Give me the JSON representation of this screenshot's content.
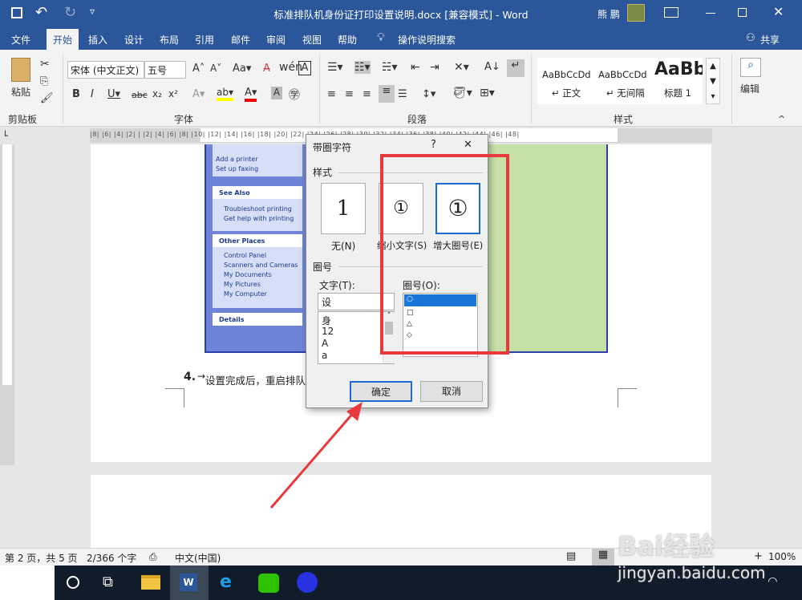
{
  "titlebar": {
    "title": "标准排队机身份证打印设置说明.docx [兼容模式] - Word",
    "user": "熊 鹏"
  },
  "tabs": [
    "文件",
    "开始",
    "插入",
    "设计",
    "布局",
    "引用",
    "邮件",
    "审阅",
    "视图",
    "帮助"
  ],
  "tellme": "操作说明搜索",
  "share": "共享",
  "ribbon": {
    "paste": "粘贴",
    "clipboard": "剪贴板",
    "font_name": "宋体 (中文正文)",
    "font_size": "五号",
    "font_group": "字体",
    "para_group": "段落",
    "styles_group": "样式",
    "edit": "编辑",
    "styles": [
      {
        "preview": "AaBbCcDd",
        "name": "↵ 正文"
      },
      {
        "preview": "AaBbCcDd",
        "name": "↵ 无间隔"
      },
      {
        "preview": "AaBb",
        "name": "标题 1"
      }
    ]
  },
  "ruler_marks": "|8| |6| |4| |2| | |2| |4| |6| |8| |10| |12| |14| |16| |18| |20| |22| |24| |26| |28| |30| |32| |34| |36| |38| |40| |42| |44| |46| |48|",
  "xp_panel": {
    "printer_tasks": [
      "Add a printer",
      "Set up faxing"
    ],
    "see_also": "See Also",
    "see_also_items": [
      "Troubleshoot printing",
      "Get help with printing"
    ],
    "other_places": "Other Places",
    "other_items": [
      "Control Panel",
      "Scanners and Cameras",
      "My Documents",
      "My Pictures",
      "My Computer"
    ],
    "details": "Details"
  },
  "doc": {
    "step_num": "4.",
    "step_text": "设置完成后，重启排队"
  },
  "dialog": {
    "title": "带圈字符",
    "help": "?",
    "close": "✕",
    "style_label": "样式",
    "options": [
      {
        "glyph": "1",
        "label": "无(N)"
      },
      {
        "glyph": "①",
        "label": "缩小文字(S)"
      },
      {
        "glyph": "①",
        "label": "增大圈号(E)"
      }
    ],
    "circle_label": "圈号",
    "text_label": "文字(T):",
    "text_value": "设",
    "text_items": [
      "身",
      "12",
      "A",
      "a"
    ],
    "enclosure_label": "圈号(O):",
    "enclosure_items": [
      "○",
      "□",
      "△",
      "◇"
    ],
    "ok": "确定",
    "cancel": "取消"
  },
  "status": {
    "page": "第 2 页，共 5 页",
    "words": "2/366 个字",
    "lang": "中文(中国)",
    "zoom": "100%"
  },
  "watermark": {
    "logo": "Bai经验",
    "url": "jingyan.baidu.com"
  },
  "colors": {
    "word_blue": "#2b579a",
    "highlight_red": "#e8393c",
    "xp_blue": "#6f84d8",
    "sheet_green": "#c6e0a8"
  }
}
